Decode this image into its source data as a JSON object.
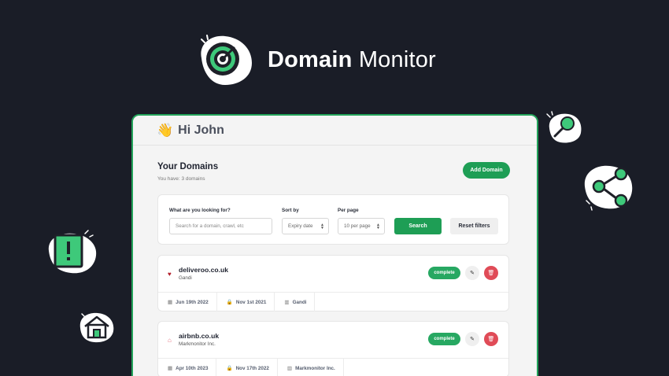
{
  "brand": {
    "name_bold": "Domain",
    "name_light": "Monitor"
  },
  "app": {
    "greeting": "Hi John",
    "greeting_emoji": "👋",
    "section_title": "Your Domains",
    "section_subtitle": "You have: 3 domains",
    "add_domain_label": "Add Domain",
    "filters": {
      "search_label": "What are you looking for?",
      "search_placeholder": "Search for a domain, crawl, etc",
      "sort_label": "Sort by",
      "sort_value": "Expiry date",
      "per_page_label": "Per page",
      "per_page_value": "10 per page",
      "search_button": "Search",
      "reset_button": "Reset filters"
    },
    "domains": [
      {
        "name": "deliveroo.co.uk",
        "registrar": "Gandi",
        "status": "complete",
        "icon": "heart-icon",
        "icon_color": "#b3202c",
        "expiry": "Jun 19th 2022",
        "registered": "Nov 1st 2021",
        "registrar_meta": "Gandi"
      },
      {
        "name": "airbnb.co.uk",
        "registrar": "Markmonitor Inc.",
        "status": "complete",
        "icon": "airbnb-icon",
        "icon_color": "#e36b78",
        "expiry": "Apr 10th 2023",
        "registered": "Nov 17th 2022",
        "registrar_meta": "Markmonitor Inc."
      }
    ]
  },
  "colors": {
    "background": "#1a1d27",
    "accent": "#1e9e55",
    "danger": "#e04b57"
  }
}
